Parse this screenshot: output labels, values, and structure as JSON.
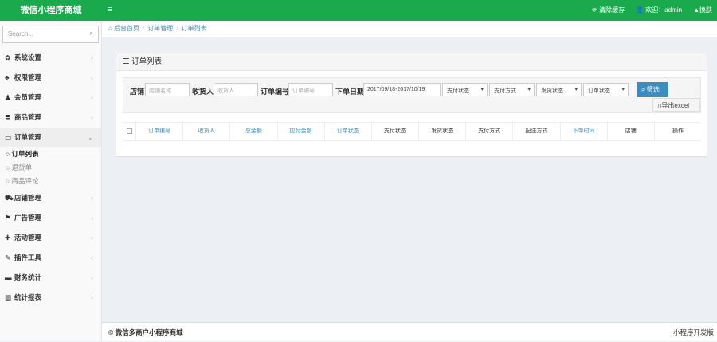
{
  "header": {
    "title": "微信小程序商城",
    "clear_cache": "清除缓存",
    "welcome": "欢迎：admin",
    "skin": "换肤"
  },
  "sidebar": {
    "search_placeholder": "Search...",
    "items": [
      {
        "label": "系统设置",
        "icon": "gear-icon"
      },
      {
        "label": "权限管理",
        "icon": "sitemap-icon"
      },
      {
        "label": "会员管理",
        "icon": "user-icon"
      },
      {
        "label": "商品管理",
        "icon": "list-icon"
      },
      {
        "label": "订单管理",
        "icon": "money-icon"
      },
      {
        "label": "店铺管理",
        "icon": "cart-icon"
      },
      {
        "label": "广告管理",
        "icon": "flag-icon"
      },
      {
        "label": "活动管理",
        "icon": "plus-icon"
      },
      {
        "label": "插件工具",
        "icon": "wrench-icon"
      },
      {
        "label": "财务统计",
        "icon": "card-icon"
      },
      {
        "label": "统计报表",
        "icon": "chart-icon"
      }
    ],
    "sub_items": [
      {
        "label": "订单列表"
      },
      {
        "label": "退货单"
      },
      {
        "label": "商品评论"
      }
    ]
  },
  "breadcrumb": [
    "后台首页",
    "订单管理",
    "订单列表"
  ],
  "panel": {
    "title": "订单列表"
  },
  "filter": {
    "shop_label": "店铺",
    "shop_placeholder": "店铺名称",
    "receiver_label": "收货人",
    "receiver_placeholder": "收货人",
    "order_no_label": "订单编号",
    "order_no_placeholder": "订单编号",
    "date_label": "下单日期",
    "date_value": "2017/09/18-2017/10/19",
    "pay_status": "支付状态",
    "pay_method": "支付方式",
    "ship_status": "发货状态",
    "order_status": "订单状态",
    "search_button": "筛选",
    "export_button": "导出excel"
  },
  "table": {
    "headers": [
      "订单编号",
      "收货人",
      "总金额",
      "应付金额",
      "订单状态",
      "支付状态",
      "发货状态",
      "支付方式",
      "配送方式",
      "下单时间",
      "店铺",
      "操作"
    ]
  },
  "footer": {
    "copyright": "© 微信多商户小程序商城",
    "right": "小程序开发版"
  }
}
